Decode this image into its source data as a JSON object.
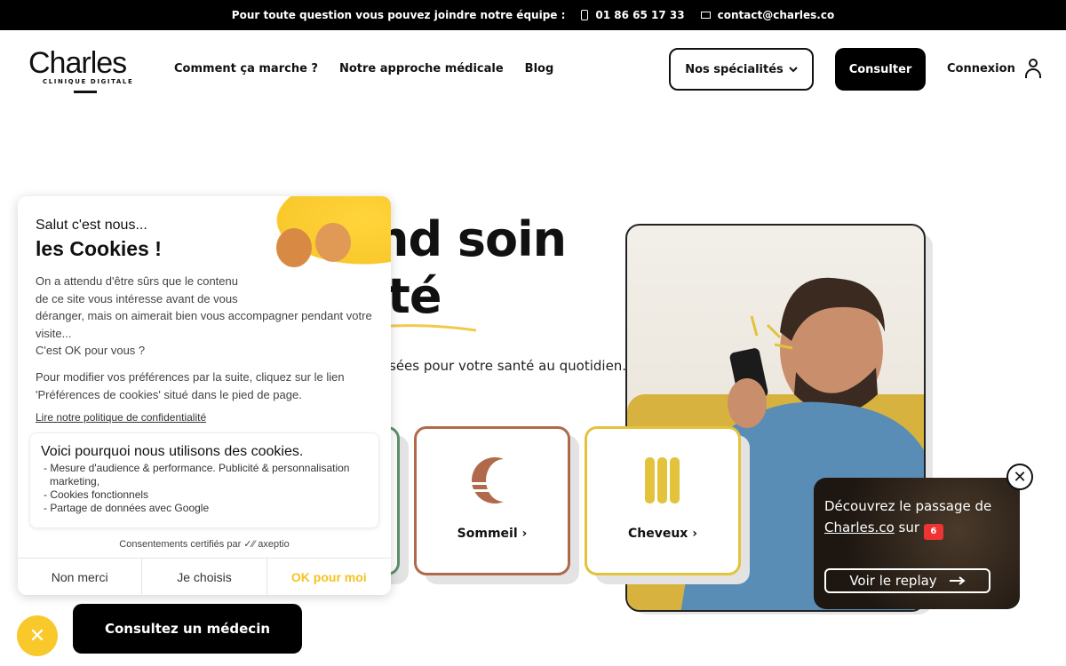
{
  "topbar": {
    "message": "Pour toute question vous pouvez joindre notre équipe :",
    "phone": "01 86 65 17 33",
    "email": "contact@charles.co"
  },
  "header": {
    "logo_word": "Charles",
    "logo_sub": "CLINIQUE DIGITALE",
    "nav": [
      "Comment ça marche ?",
      "Notre approche médicale",
      "Blog"
    ],
    "specialites_label": "Nos spécialités",
    "consulter_label": "Consulter",
    "connexion_label": "Connexion"
  },
  "hero": {
    "title_line1": "nd soin",
    "title_line2": "té",
    "subtitle": "sées pour votre santé au quotidien.",
    "accent_color": "#f2c94c"
  },
  "cards": [
    {
      "label": "Sommeil",
      "border_color": "#b0694b",
      "icon": "moon-icon"
    },
    {
      "label": "Cheveux",
      "border_color": "#e3c23c",
      "icon": "hair-icon"
    }
  ],
  "video_popup": {
    "text_before": "Découvrez le passage de",
    "link": "Charles.co",
    "text_after": "sur",
    "channel": "6",
    "replay_label": "Voir le replay"
  },
  "cookie": {
    "hello": "Salut c'est nous...",
    "title": "les Cookies !",
    "p1_lines": [
      "On a attendu d'être sûrs que le contenu",
      "de ce site vous intéresse avant de vous",
      "déranger, mais on aimerait bien vous accompagner pendant votre",
      "visite...",
      "C'est OK pour vous ?"
    ],
    "p2_lines": [
      "Pour modifier vos préférences par la suite, cliquez sur le lien",
      "'Préférences de cookies' situé dans le pied de page."
    ],
    "policy_link": "Lire notre politique de confidentialité",
    "box_title": "Voici pourquoi nous utilisons des cookies.",
    "reasons": [
      "- Mesure d'audience & performance. Publicité & personnalisation",
      "  marketing,",
      "- Cookies fonctionnels",
      "- Partage de données avec Google"
    ],
    "certified": "Consentements certifiés par ✓⁄⁄ axeptio",
    "btn_refuse": "Non merci",
    "btn_choose": "Je choisis",
    "btn_accept": "OK pour moi"
  },
  "cta_doctor": "Consultez un médecin"
}
